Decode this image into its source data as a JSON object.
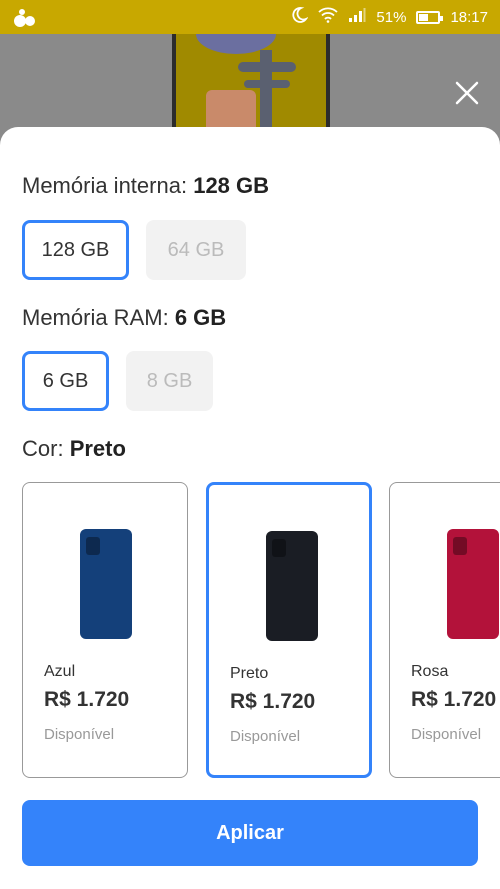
{
  "status_bar": {
    "battery": "51%",
    "battery_level": 0.51,
    "time": "18:17",
    "icons": [
      "app-logo-icon",
      "moon-icon",
      "wifi-icon",
      "signal-icon",
      "battery-icon"
    ]
  },
  "close_icon": "close-icon",
  "memory": {
    "label": "Memória interna:",
    "value": "128 GB",
    "options": [
      {
        "label": "128 GB",
        "state": "selected"
      },
      {
        "label": "64 GB",
        "state": "disabled"
      }
    ]
  },
  "ram": {
    "label": "Memória RAM:",
    "value": "6 GB",
    "options": [
      {
        "label": "6 GB",
        "state": "selected"
      },
      {
        "label": "8 GB",
        "state": "disabled"
      }
    ]
  },
  "color": {
    "label": "Cor:",
    "value": "Preto",
    "options": [
      {
        "name": "Azul",
        "price": "R$ 1.720",
        "availability": "Disponível",
        "phone_color": "#14407a",
        "state": "normal"
      },
      {
        "name": "Preto",
        "price": "R$ 1.720",
        "availability": "Disponível",
        "phone_color": "#1a1d24",
        "state": "selected"
      },
      {
        "name": "Rosa",
        "price": "R$ 1.720",
        "availability": "Disponível",
        "phone_color": "#b3123a",
        "state": "normal"
      }
    ]
  },
  "apply_label": "Aplicar",
  "colors": {
    "accent": "#3483fa",
    "status_bar": "#c8a800"
  }
}
